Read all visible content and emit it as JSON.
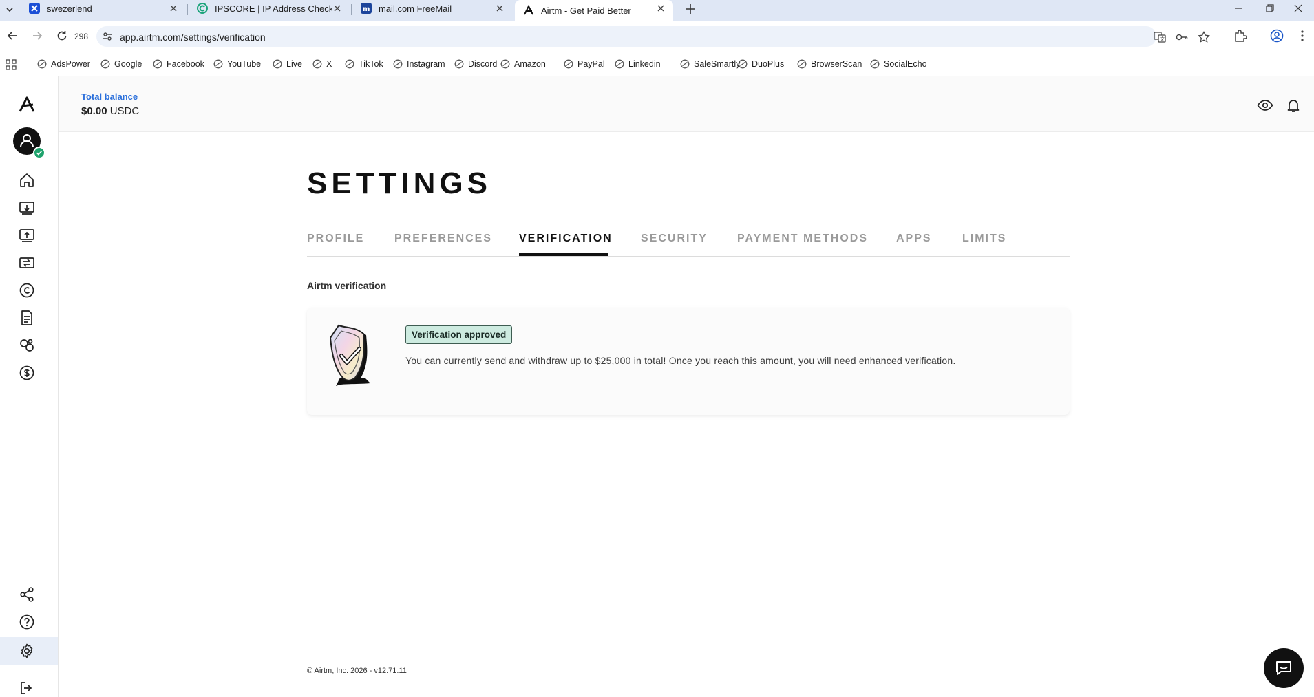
{
  "browser": {
    "tabs": [
      {
        "title": "swezerlend",
        "icon": "x-favicon-icon"
      },
      {
        "title": "IPSCORE | IP Address Checker a",
        "icon": "ipscore-favicon-icon"
      },
      {
        "title": "mail.com FreeMail",
        "icon": "mailcom-favicon-icon"
      },
      {
        "title": "Airtm - Get Paid Better",
        "icon": "airtm-favicon-icon"
      }
    ],
    "reload_count": "298",
    "url": "app.airtm.com/settings/verification",
    "bookmarks": [
      "AdsPower",
      "Google",
      "Facebook",
      "YouTube",
      "Live",
      "X",
      "TikTok",
      "Instagram",
      "Discord",
      "Amazon",
      "PayPal",
      "Linkedin",
      "SaleSmartly",
      "DuoPlus",
      "BrowserScan",
      "SocialEcho"
    ]
  },
  "header": {
    "balance_label": "Total balance",
    "balance_amount": "$0.00",
    "balance_currency": "USDC"
  },
  "sidebar": {
    "icons": [
      "home-icon",
      "deposit-icon",
      "withdraw-icon",
      "transfer-icon",
      "crypto-icon",
      "document-icon",
      "services-icon",
      "dollar-icon"
    ],
    "bottom_icons": [
      "share-icon",
      "help-icon",
      "settings-icon",
      "logout-icon"
    ],
    "active": "settings-icon"
  },
  "settings": {
    "title": "SETTINGS",
    "tabs": [
      "PROFILE",
      "PREFERENCES",
      "VERIFICATION",
      "SECURITY",
      "PAYMENT METHODS",
      "APPS",
      "LIMITS"
    ],
    "active_tab": "VERIFICATION",
    "section_title": "Airtm verification",
    "badge": "Verification approved",
    "message": "You can currently send and withdraw up to $25,000 in total! Once you reach this amount, you will need enhanced verification."
  },
  "footer": {
    "text": "© Airtm, Inc. 2026 - v12.71.11"
  },
  "colors": {
    "accent_blue": "#2a6fdb",
    "badge_bg": "#cdebe0",
    "status_green": "#1fa36d"
  }
}
